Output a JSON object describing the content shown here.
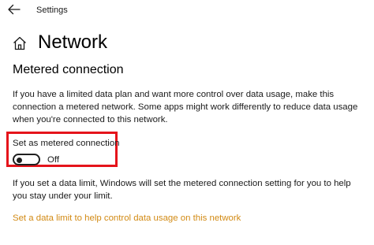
{
  "window": {
    "title": "Settings"
  },
  "header": {
    "title": "Network"
  },
  "section": {
    "title": "Metered connection",
    "description": "If you have a limited data plan and want more control over data usage, make this connection a metered network. Some apps might work differently to reduce data usage when you're connected to this network."
  },
  "metered": {
    "label": "Set as metered connection",
    "state_label": "Off",
    "enabled": false
  },
  "data_limit": {
    "info": "If you set a data limit, Windows will set the metered connection setting for you to help you stay under your limit.",
    "link": "Set a data limit to help control data usage on this network"
  },
  "icons": {
    "back": "back-arrow-icon",
    "home": "home-icon"
  },
  "colors": {
    "highlight": "#e5141b",
    "link": "#d28a14",
    "text": "#1a1a1a"
  }
}
